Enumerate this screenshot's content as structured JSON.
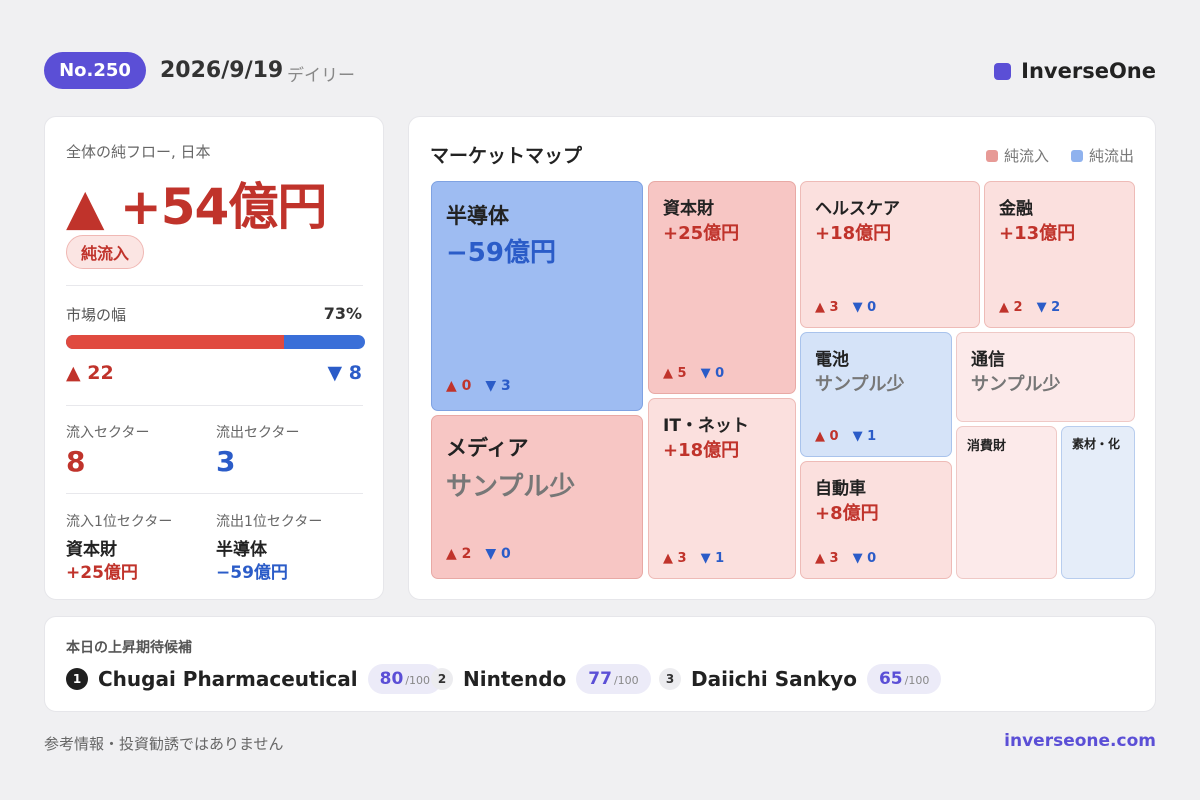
{
  "header": {
    "issue": "No.250",
    "date": "2026/9/19",
    "period": "デイリー",
    "brand": "InverseOne"
  },
  "summary": {
    "label": "全体の純フロー, 日本",
    "total": "▲ +54億円",
    "badge": "純流入",
    "breadth_label": "市場の幅",
    "breadth_pct": "73%",
    "breadth_value": 0.73,
    "advancers": "▲ 22",
    "decliners": "▼ 8",
    "inflow_sectors_label": "流入セクター",
    "inflow_sectors": "8",
    "outflow_sectors_label": "流出セクター",
    "outflow_sectors": "3",
    "top_inflow_label": "流入1位セクター",
    "top_inflow_name": "資本財",
    "top_inflow_value": "+25億円",
    "top_outflow_label": "流出1位セクター",
    "top_outflow_name": "半導体",
    "top_outflow_value": "−59億円"
  },
  "market_map": {
    "title": "マーケットマップ",
    "legend_in": "純流入",
    "legend_out": "純流出",
    "color_in": "#e79a96",
    "color_out": "#8fb2ee",
    "tiles": [
      {
        "name": "半導体",
        "value": "−59億円",
        "up": "▲ 0",
        "down": "▼ 3"
      },
      {
        "name": "メディア",
        "value": "サンプル少",
        "up": "▲ 2",
        "down": "▼ 0"
      },
      {
        "name": "資本財",
        "value": "+25億円",
        "up": "▲ 5",
        "down": "▼ 0"
      },
      {
        "name": "IT・ネット",
        "value": "+18億円",
        "up": "▲ 3",
        "down": "▼ 1"
      },
      {
        "name": "ヘルスケア",
        "value": "+18億円",
        "up": "▲ 3",
        "down": "▼ 0"
      },
      {
        "name": "金融",
        "value": "+13億円",
        "up": "▲ 2",
        "down": "▼ 2"
      },
      {
        "name": "電池",
        "value": "サンプル少",
        "up": "▲ 0",
        "down": "▼ 1"
      },
      {
        "name": "通信",
        "value": "サンプル少"
      },
      {
        "name": "自動車",
        "value": "+8億円",
        "up": "▲ 3",
        "down": "▼ 0"
      },
      {
        "name": "消費財"
      },
      {
        "name": "素材・化"
      }
    ]
  },
  "candidates": {
    "label": "本日の上昇期待候補",
    "items": [
      {
        "rank": "1",
        "name": "Chugai Pharmaceutical",
        "score": "80",
        "max": "/100"
      },
      {
        "rank": "2",
        "name": "Nintendo",
        "score": "77",
        "max": "/100"
      },
      {
        "rank": "3",
        "name": "Daiichi Sankyo",
        "score": "65",
        "max": "/100"
      }
    ]
  },
  "footer": {
    "disclaimer": "参考情報・投資勧誘ではありません",
    "site": "inverseone.com"
  }
}
